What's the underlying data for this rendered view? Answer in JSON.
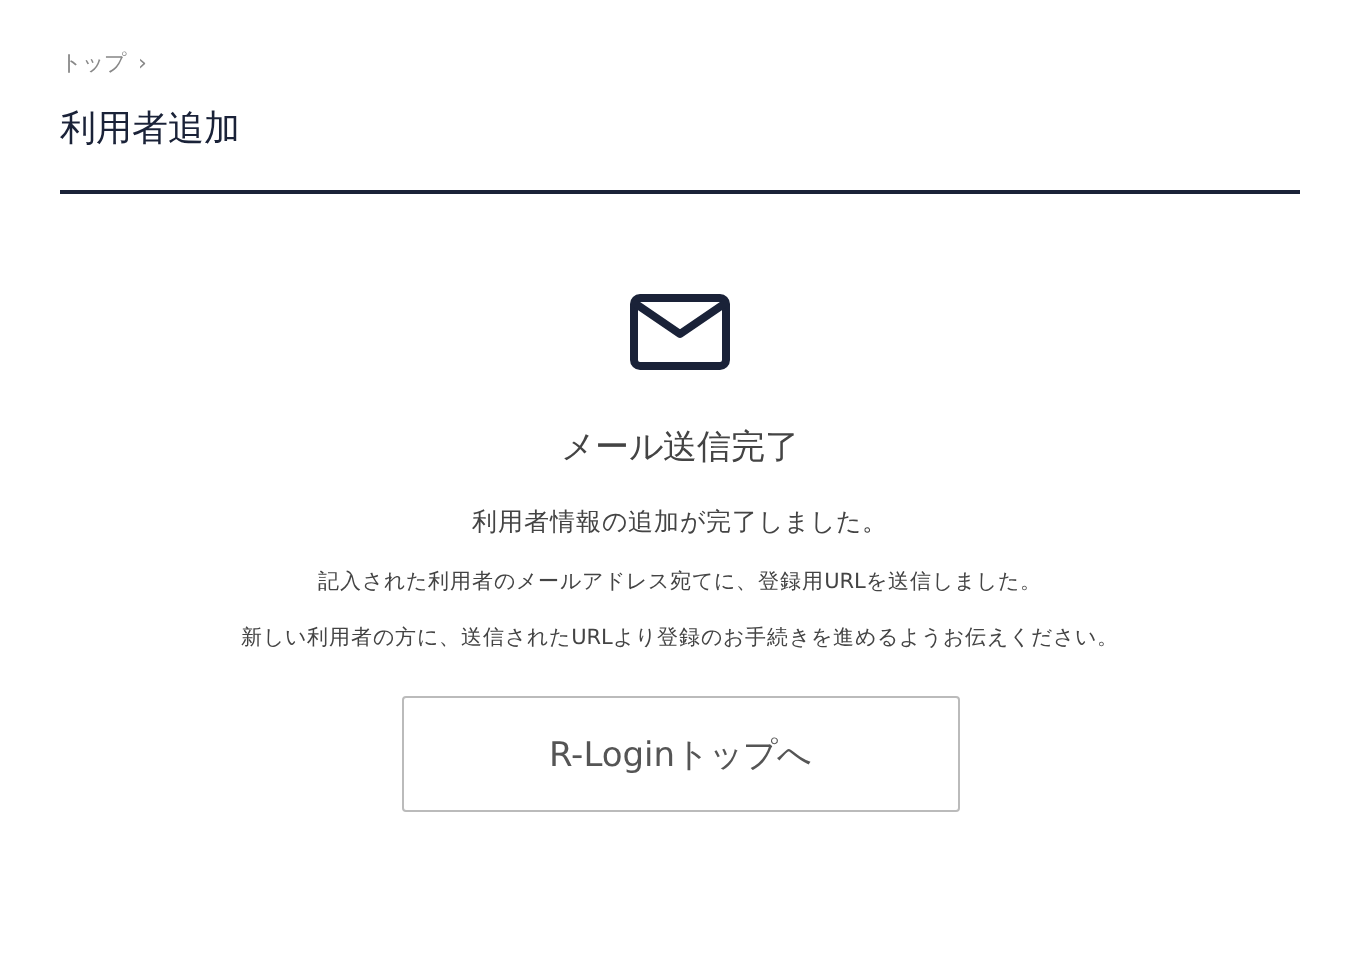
{
  "breadcrumb": [
    {
      "label": "トップ",
      "separator": "›"
    }
  ],
  "page_title": "利用者追加",
  "heading": "メール送信完了",
  "message": "利用者情報の追加が完了しました。",
  "notes": [
    "記入された利用者のメールアドレス宛てに、登録用URLを送信しました。",
    "新しい利用者の方に、送信されたURLより登録のお手続きを進めるようお伝えください。"
  ],
  "button": "R-Loginトップへ"
}
